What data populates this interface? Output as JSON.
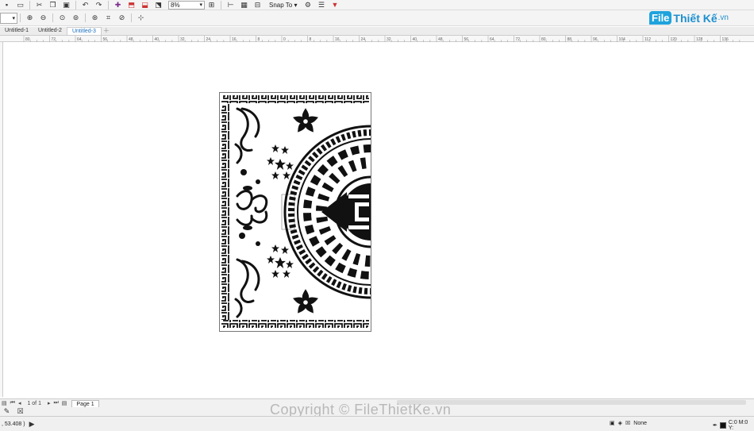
{
  "toolbar": {
    "zoom_value": "8%",
    "snap_label": "Snap To",
    "icons": [
      "save-icon",
      "print-icon",
      "cut-icon",
      "copy-icon",
      "paste-icon",
      "undo-icon",
      "redo-icon",
      "search-content-icon",
      "import-icon",
      "export-icon",
      "publish-icon",
      "zoom-icon",
      "fullscreen-icon",
      "rulers-icon",
      "options-icon",
      "launch-icon",
      "print-merge-icon"
    ]
  },
  "logo": {
    "bubble": "File",
    "text": "Thiết Kế",
    "suffix": ".vn"
  },
  "tabs": [
    "Untitled-1",
    "Untitled-2",
    "Untitled-3"
  ],
  "active_tab": "Untitled-3",
  "ruler_labels": [
    "80",
    "72",
    "64",
    "56",
    "48",
    "40",
    "32",
    "24",
    "16",
    "8",
    "0",
    "8",
    "16",
    "24",
    "32",
    "40",
    "48",
    "56",
    "64",
    "72",
    "80",
    "88",
    "96",
    "104",
    "112",
    "120",
    "128",
    "136"
  ],
  "pager": {
    "page_count": "1 of 1",
    "page_tab": "Page 1"
  },
  "watermark": "Copyright © FileThietKe.vn",
  "status": {
    "coords": ", 53.408 )",
    "fill_label": "None",
    "outline_label": "C:0 M:0 Y:"
  },
  "colors": {
    "accent": "#1d8fd0",
    "page_border": "#777777",
    "ink": "#111111"
  }
}
